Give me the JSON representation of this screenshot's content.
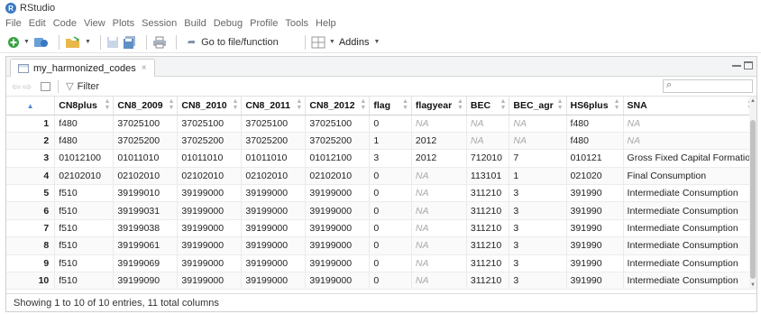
{
  "app": {
    "title": "RStudio",
    "logo_letter": "R"
  },
  "menu": [
    "File",
    "Edit",
    "Code",
    "View",
    "Plots",
    "Session",
    "Build",
    "Debug",
    "Profile",
    "Tools",
    "Help"
  ],
  "toolbar": {
    "goto_label": "Go to file/function",
    "addins_label": "Addins"
  },
  "tab": {
    "label": "my_harmonized_codes",
    "close": "×"
  },
  "filter": {
    "label": "Filter"
  },
  "table": {
    "columns": [
      "CN8plus",
      "CN8_2009",
      "CN8_2010",
      "CN8_2011",
      "CN8_2012",
      "flag",
      "flagyear",
      "BEC",
      "BEC_agr",
      "HS6plus",
      "SNA"
    ],
    "rows": [
      [
        "1",
        "f480",
        "37025100",
        "37025100",
        "37025100",
        "37025100",
        "0",
        "NA",
        "NA",
        "NA",
        "f480",
        "NA"
      ],
      [
        "2",
        "f480",
        "37025200",
        "37025200",
        "37025200",
        "37025200",
        "1",
        "2012",
        "NA",
        "NA",
        "f480",
        "NA"
      ],
      [
        "3",
        "01012100",
        "01011010",
        "01011010",
        "01011010",
        "01012100",
        "3",
        "2012",
        "712010",
        "7",
        "010121",
        "Gross Fixed Capital Formation"
      ],
      [
        "4",
        "02102010",
        "02102010",
        "02102010",
        "02102010",
        "02102010",
        "0",
        "NA",
        "113101",
        "1",
        "021020",
        "Final Consumption"
      ],
      [
        "5",
        "f510",
        "39199010",
        "39199000",
        "39199000",
        "39199000",
        "0",
        "NA",
        "311210",
        "3",
        "391990",
        "Intermediate Consumption"
      ],
      [
        "6",
        "f510",
        "39199031",
        "39199000",
        "39199000",
        "39199000",
        "0",
        "NA",
        "311210",
        "3",
        "391990",
        "Intermediate Consumption"
      ],
      [
        "7",
        "f510",
        "39199038",
        "39199000",
        "39199000",
        "39199000",
        "0",
        "NA",
        "311210",
        "3",
        "391990",
        "Intermediate Consumption"
      ],
      [
        "8",
        "f510",
        "39199061",
        "39199000",
        "39199000",
        "39199000",
        "0",
        "NA",
        "311210",
        "3",
        "391990",
        "Intermediate Consumption"
      ],
      [
        "9",
        "f510",
        "39199069",
        "39199000",
        "39199000",
        "39199000",
        "0",
        "NA",
        "311210",
        "3",
        "391990",
        "Intermediate Consumption"
      ],
      [
        "10",
        "f510",
        "39199090",
        "39199000",
        "39199000",
        "39199000",
        "0",
        "NA",
        "311210",
        "3",
        "391990",
        "Intermediate Consumption"
      ]
    ]
  },
  "status": "Showing 1 to 10 of 10 entries, 11 total columns"
}
